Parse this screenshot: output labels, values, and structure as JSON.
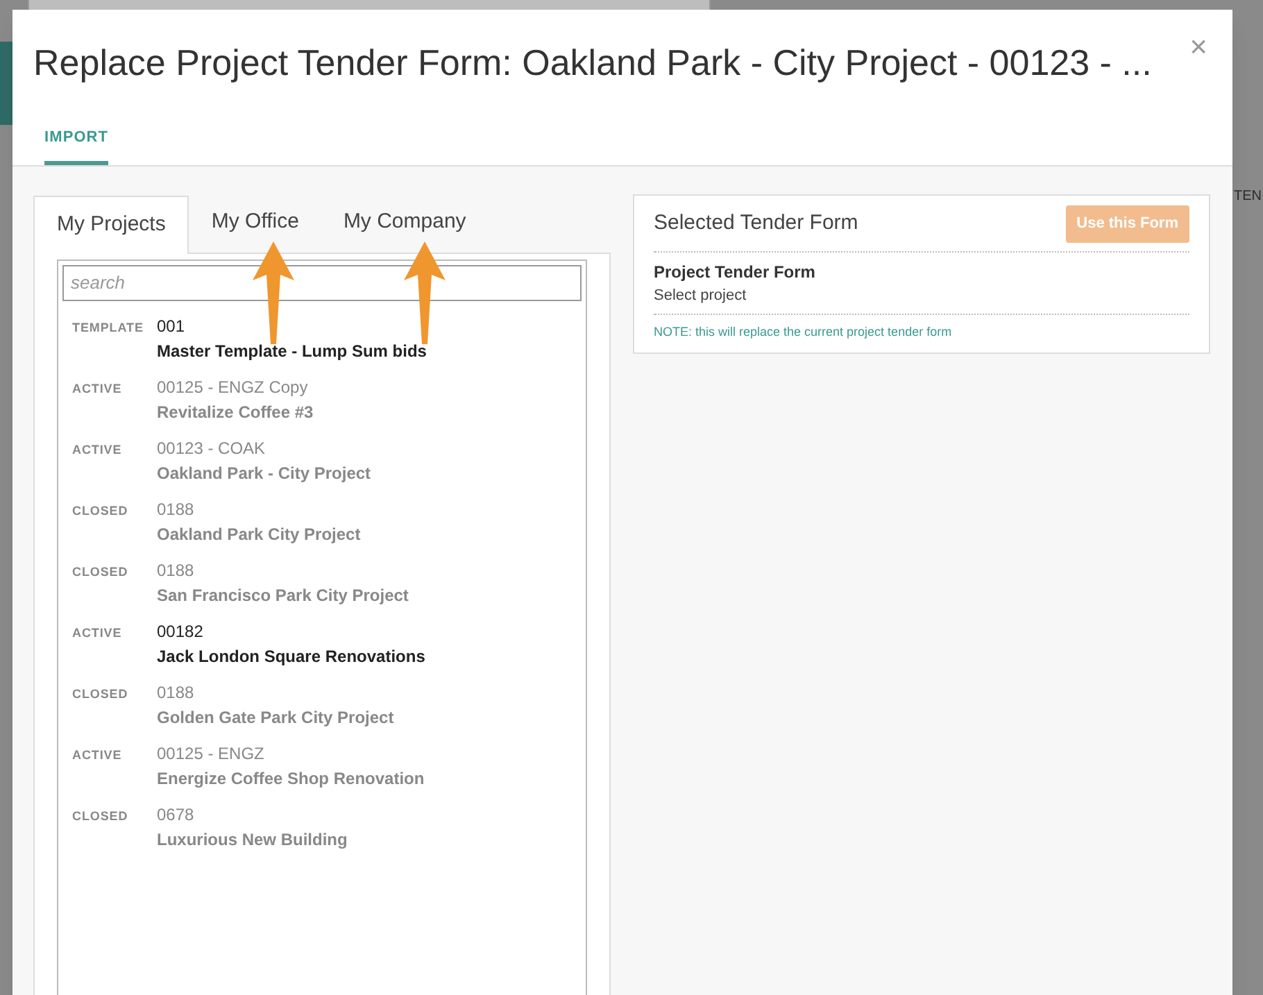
{
  "backdrop": {
    "column_heading": "TEN"
  },
  "dialog": {
    "title": "Replace Project Tender Form: Oakland Park - City Project - 00123 - ...",
    "close": "×",
    "tabs": [
      {
        "label": "IMPORT",
        "selected": true
      }
    ],
    "source_tabs": [
      {
        "label": "My Projects",
        "selected": true
      },
      {
        "label": "My Office",
        "selected": false
      },
      {
        "label": "My Company",
        "selected": false
      }
    ],
    "search": {
      "placeholder": "search"
    },
    "projects": [
      {
        "status": "TEMPLATE",
        "code": "001",
        "name": "Master Template - Lump Sum bids",
        "dimmed": false
      },
      {
        "status": "ACTIVE",
        "code": "00125 - ENGZ Copy",
        "name": "Revitalize Coffee #3",
        "dimmed": true
      },
      {
        "status": "ACTIVE",
        "code": "00123 - COAK",
        "name": "Oakland Park - City Project",
        "dimmed": true
      },
      {
        "status": "CLOSED",
        "code": "0188",
        "name": "Oakland Park City Project",
        "dimmed": true
      },
      {
        "status": "CLOSED",
        "code": "0188",
        "name": "San Francisco Park City Project",
        "dimmed": true
      },
      {
        "status": "ACTIVE",
        "code": "00182",
        "name": "Jack London Square Renovations",
        "dimmed": false
      },
      {
        "status": "CLOSED",
        "code": "0188",
        "name": "Golden Gate Park City Project",
        "dimmed": true
      },
      {
        "status": "ACTIVE",
        "code": "00125 - ENGZ",
        "name": "Energize Coffee Shop Renovation",
        "dimmed": true
      },
      {
        "status": "CLOSED",
        "code": "0678",
        "name": "Luxurious New Building",
        "dimmed": true
      }
    ],
    "selected_form": {
      "heading": "Selected Tender Form",
      "button": {
        "label": "Use this Form",
        "disabled": true
      },
      "form_name": "Project Tender Form",
      "form_value": "Select project",
      "note": "NOTE: this will replace the current project tender form"
    }
  }
}
